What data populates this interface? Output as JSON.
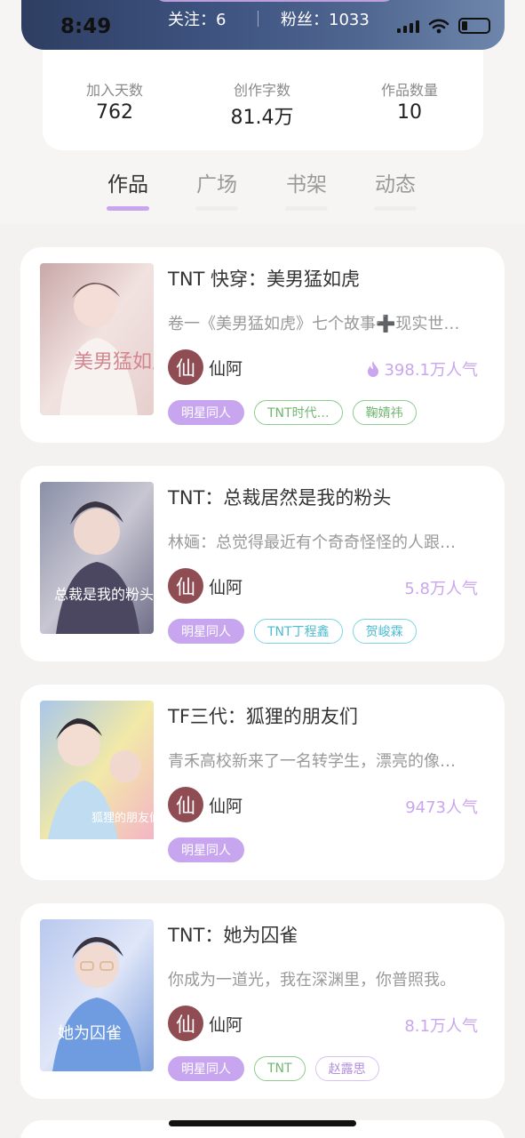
{
  "status_bar": {
    "time": "8:49"
  },
  "profile": {
    "follow_text": "关注：6",
    "fans_text": "粉丝：1033",
    "stats": [
      {
        "label": "加入天数",
        "value": "762"
      },
      {
        "label": "创作字数",
        "value": "81.4万"
      },
      {
        "label": "作品数量",
        "value": "10"
      }
    ]
  },
  "tabs": [
    {
      "label": "作品",
      "active": true
    },
    {
      "label": "广场",
      "active": false
    },
    {
      "label": "书架",
      "active": false
    },
    {
      "label": "动态",
      "active": false
    }
  ],
  "books": [
    {
      "title": "TNT 快穿：美男猛如虎",
      "description": "卷一《美男猛如虎》七个故事➕现实世…",
      "author": "仙阿",
      "avatar_char": "仙",
      "popularity": "398.1万人气",
      "popularity_icon": "flame-icon",
      "cover_text": "美男猛如虎",
      "tags": [
        "明星同人",
        "TNT时代…",
        "鞠婧祎"
      ]
    },
    {
      "title": "TNT：总裁居然是我的粉头",
      "description": "林婳：总觉得最近有个奇奇怪怪的人跟…",
      "author": "仙阿",
      "avatar_char": "仙",
      "popularity": "5.8万人气",
      "cover_text": "总裁是我的粉头",
      "tags": [
        "明星同人",
        "TNT丁程鑫",
        "贺峻霖"
      ]
    },
    {
      "title": "TF三代：狐狸的朋友们",
      "description": "青禾高校新来了一名转学生，漂亮的像…",
      "author": "仙阿",
      "avatar_char": "仙",
      "popularity": "9473人气",
      "cover_text": "狐狸的朋友们",
      "tags": [
        "明星同人"
      ]
    },
    {
      "title": "TNT：她为囚雀",
      "description": "你成为一道光，我在深渊里，你普照我。",
      "author": "仙阿",
      "avatar_char": "仙",
      "popularity": "8.1万人气",
      "cover_text": "她为囚雀",
      "tags": [
        "明星同人",
        "TNT",
        "赵露思"
      ]
    }
  ],
  "colors": {
    "accent": "#c8a6ef",
    "popularity": "#c9a6ee",
    "avatar": "#8f4c53"
  }
}
